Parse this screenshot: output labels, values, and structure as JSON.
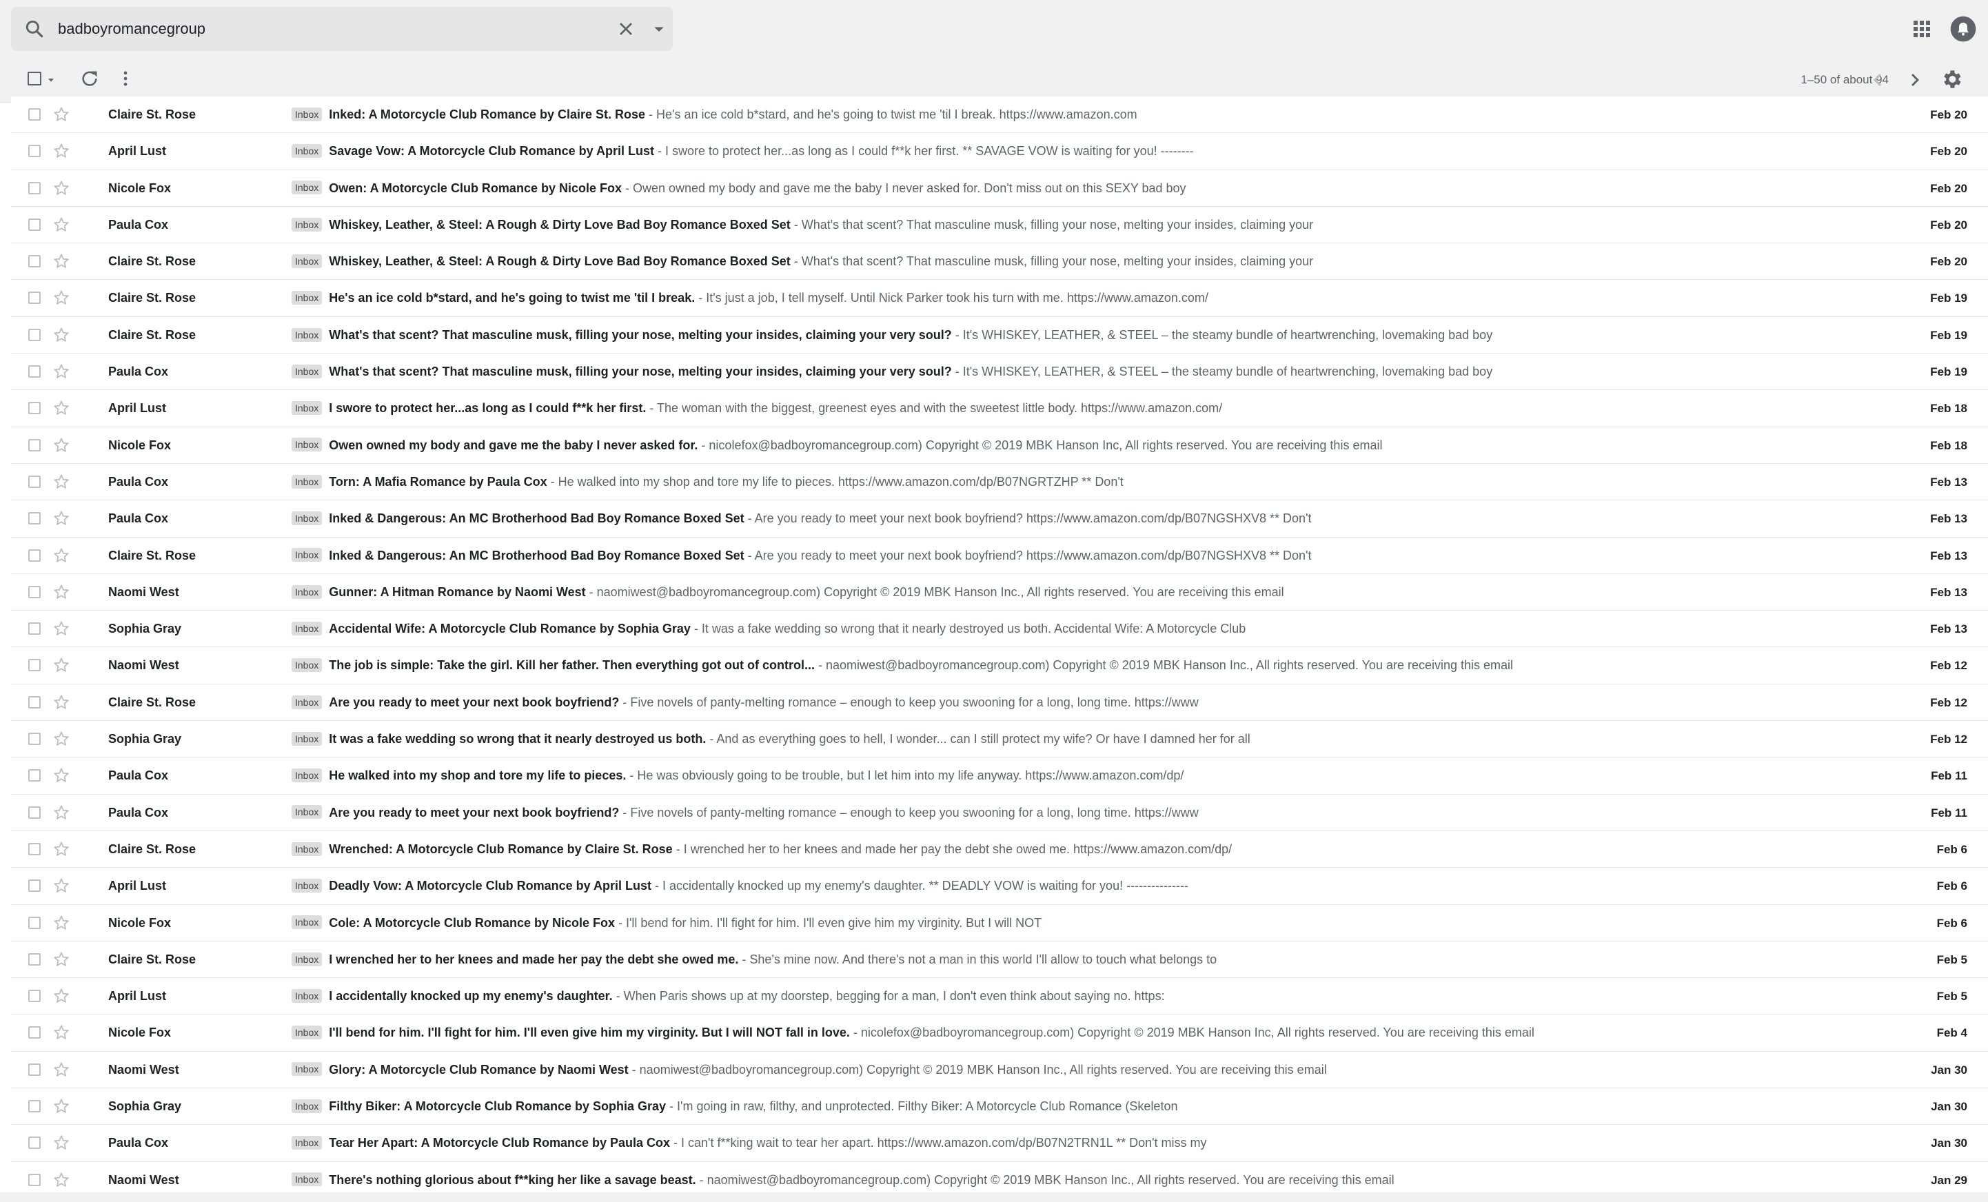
{
  "search": {
    "query": "badboyromancegroup"
  },
  "toolbar": {
    "page_count": "1–50 of about 94"
  },
  "icons": {
    "search": "search-icon",
    "clear": "close-icon",
    "search_options": "caret-down-icon",
    "apps": "apps-grid-icon",
    "notifications": "bell-icon",
    "refresh": "refresh-icon",
    "more": "more-vert-icon",
    "prev": "chevron-left-icon",
    "next": "chevron-right-icon",
    "settings": "gear-icon",
    "star": "star-outline-icon"
  },
  "colors": {
    "topbar_bg": "#f1f1f1",
    "badge_bg": "#dddddd",
    "text_primary": "#202124",
    "text_secondary": "#5f6368"
  },
  "emails": [
    {
      "sender": "Claire St. Rose",
      "label": "Inbox",
      "subject": "Inked: A Motorcycle Club Romance by Claire St. Rose",
      "snippet": " - He's an ice cold b*stard, and he's going to twist me 'til I break. https://www.amazon.com",
      "date": "Feb 20"
    },
    {
      "sender": "April Lust",
      "label": "Inbox",
      "subject": "Savage Vow: A Motorcycle Club Romance by April Lust",
      "snippet": " - I swore to protect her...as long as I could f**k her first. ** SAVAGE VOW is waiting for you! --------",
      "date": "Feb 20"
    },
    {
      "sender": "Nicole Fox",
      "label": "Inbox",
      "subject": "Owen: A Motorcycle Club Romance by Nicole Fox",
      "snippet": " - Owen owned my body and gave me the baby I never asked for. Don't miss out on this SEXY bad boy",
      "date": "Feb 20"
    },
    {
      "sender": "Paula Cox",
      "label": "Inbox",
      "subject": "Whiskey, Leather, & Steel: A Rough & Dirty Love Bad Boy Romance Boxed Set",
      "snippet": " - What's that scent? That masculine musk, filling your nose, melting your insides, claiming your",
      "date": "Feb 20"
    },
    {
      "sender": "Claire St. Rose",
      "label": "Inbox",
      "subject": "Whiskey, Leather, & Steel: A Rough & Dirty Love Bad Boy Romance Boxed Set",
      "snippet": " - What's that scent? That masculine musk, filling your nose, melting your insides, claiming your",
      "date": "Feb 20"
    },
    {
      "sender": "Claire St. Rose",
      "label": "Inbox",
      "subject": "He's an ice cold b*stard, and he's going to twist me 'til I break.",
      "snippet": " - It's just a job, I tell myself. Until Nick Parker took his turn with me. https://www.amazon.com/",
      "date": "Feb 19"
    },
    {
      "sender": "Claire St. Rose",
      "label": "Inbox",
      "subject": "What's that scent? That masculine musk, filling your nose, melting your insides, claiming your very soul?",
      "snippet": " - It's WHISKEY, LEATHER, & STEEL – the steamy bundle of heartwrenching, lovemaking bad boy",
      "date": "Feb 19"
    },
    {
      "sender": "Paula Cox",
      "label": "Inbox",
      "subject": "What's that scent? That masculine musk, filling your nose, melting your insides, claiming your very soul?",
      "snippet": " - It's WHISKEY, LEATHER, & STEEL – the steamy bundle of heartwrenching, lovemaking bad boy",
      "date": "Feb 19"
    },
    {
      "sender": "April Lust",
      "label": "Inbox",
      "subject": "I swore to protect her...as long as I could f**k her first.",
      "snippet": " - The woman with the biggest, greenest eyes and with the sweetest little body. https://www.amazon.com/",
      "date": "Feb 18"
    },
    {
      "sender": "Nicole Fox",
      "label": "Inbox",
      "subject": "Owen owned my body and gave me the baby I never asked for.",
      "snippet": " - nicolefox@badboyromancegroup.com) Copyright © 2019 MBK Hanson Inc, All rights reserved. You are receiving this email",
      "date": "Feb 18"
    },
    {
      "sender": "Paula Cox",
      "label": "Inbox",
      "subject": "Torn: A Mafia Romance by Paula Cox",
      "snippet": " - He walked into my shop and tore my life to pieces. https://www.amazon.com/dp/B07NGRTZHP ** Don't",
      "date": "Feb 13"
    },
    {
      "sender": "Paula Cox",
      "label": "Inbox",
      "subject": "Inked & Dangerous: An MC Brotherhood Bad Boy Romance Boxed Set",
      "snippet": " - Are you ready to meet your next book boyfriend? https://www.amazon.com/dp/B07NGSHXV8 ** Don't",
      "date": "Feb 13"
    },
    {
      "sender": "Claire St. Rose",
      "label": "Inbox",
      "subject": "Inked & Dangerous: An MC Brotherhood Bad Boy Romance Boxed Set",
      "snippet": " - Are you ready to meet your next book boyfriend? https://www.amazon.com/dp/B07NGSHXV8 ** Don't",
      "date": "Feb 13"
    },
    {
      "sender": "Naomi West",
      "label": "Inbox",
      "subject": "Gunner: A Hitman Romance by Naomi West",
      "snippet": " - naomiwest@badboyromancegroup.com) Copyright © 2019 MBK Hanson Inc., All rights reserved. You are receiving this email",
      "date": "Feb 13"
    },
    {
      "sender": "Sophia Gray",
      "label": "Inbox",
      "subject": "Accidental Wife: A Motorcycle Club Romance by Sophia Gray",
      "snippet": " - It was a fake wedding so wrong that it nearly destroyed us both. Accidental Wife: A Motorcycle Club",
      "date": "Feb 13"
    },
    {
      "sender": "Naomi West",
      "label": "Inbox",
      "subject": "The job is simple: Take the girl. Kill her father. Then everything got out of control...",
      "snippet": " - naomiwest@badboyromancegroup.com) Copyright © 2019 MBK Hanson Inc., All rights reserved. You are receiving this email",
      "date": "Feb 12"
    },
    {
      "sender": "Claire St. Rose",
      "label": "Inbox",
      "subject": "Are you ready to meet your next book boyfriend?",
      "snippet": " - Five novels of panty-melting romance – enough to keep you swooning for a long, long time. https://www",
      "date": "Feb 12"
    },
    {
      "sender": "Sophia Gray",
      "label": "Inbox",
      "subject": "It was a fake wedding so wrong that it nearly destroyed us both.",
      "snippet": " - And as everything goes to hell, I wonder... can I still protect my wife? Or have I damned her for all",
      "date": "Feb 12"
    },
    {
      "sender": "Paula Cox",
      "label": "Inbox",
      "subject": "He walked into my shop and tore my life to pieces.",
      "snippet": " - He was obviously going to be trouble, but I let him into my life anyway. https://www.amazon.com/dp/",
      "date": "Feb 11"
    },
    {
      "sender": "Paula Cox",
      "label": "Inbox",
      "subject": "Are you ready to meet your next book boyfriend?",
      "snippet": " - Five novels of panty-melting romance – enough to keep you swooning for a long, long time. https://www",
      "date": "Feb 11"
    },
    {
      "sender": "Claire St. Rose",
      "label": "Inbox",
      "subject": "Wrenched: A Motorcycle Club Romance by Claire St. Rose",
      "snippet": " - I wrenched her to her knees and made her pay the debt she owed me. https://www.amazon.com/dp/",
      "date": "Feb 6"
    },
    {
      "sender": "April Lust",
      "label": "Inbox",
      "subject": "Deadly Vow: A Motorcycle Club Romance by April Lust",
      "snippet": " - I accidentally knocked up my enemy's daughter. ** DEADLY VOW is waiting for you! ---------------",
      "date": "Feb 6"
    },
    {
      "sender": "Nicole Fox",
      "label": "Inbox",
      "subject": "Cole: A Motorcycle Club Romance by Nicole Fox",
      "snippet": " - I'll bend for him. I'll fight for him. I'll even give him my virginity. But I will NOT",
      "date": "Feb 6"
    },
    {
      "sender": "Claire St. Rose",
      "label": "Inbox",
      "subject": "I wrenched her to her knees and made her pay the debt she owed me.",
      "snippet": " - She's mine now. And there's not a man in this world I'll allow to touch what belongs to",
      "date": "Feb 5"
    },
    {
      "sender": "April Lust",
      "label": "Inbox",
      "subject": "I accidentally knocked up my enemy's daughter.",
      "snippet": " - When Paris shows up at my doorstep, begging for a man, I don't even think about saying no. https:",
      "date": "Feb 5"
    },
    {
      "sender": "Nicole Fox",
      "label": "Inbox",
      "subject": "I'll bend for him. I'll fight for him. I'll even give him my virginity. But I will NOT fall in love.",
      "snippet": " - nicolefox@badboyromancegroup.com) Copyright © 2019 MBK Hanson Inc, All rights reserved. You are receiving this email",
      "date": "Feb 4"
    },
    {
      "sender": "Naomi West",
      "label": "Inbox",
      "subject": "Glory: A Motorcycle Club Romance by Naomi West",
      "snippet": " - naomiwest@badboyromancegroup.com) Copyright © 2019 MBK Hanson Inc., All rights reserved. You are receiving this email",
      "date": "Jan 30"
    },
    {
      "sender": "Sophia Gray",
      "label": "Inbox",
      "subject": "Filthy Biker: A Motorcycle Club Romance by Sophia Gray",
      "snippet": " - I'm going in raw, filthy, and unprotected. Filthy Biker: A Motorcycle Club Romance (Skeleton",
      "date": "Jan 30"
    },
    {
      "sender": "Paula Cox",
      "label": "Inbox",
      "subject": "Tear Her Apart: A Motorcycle Club Romance by Paula Cox",
      "snippet": " - I can't f**king wait to tear her apart. https://www.amazon.com/dp/B07N2TRN1L ** Don't miss my",
      "date": "Jan 30"
    },
    {
      "sender": "Naomi West",
      "label": "Inbox",
      "subject": "There's nothing glorious about f**king her like a savage beast.",
      "snippet": " - naomiwest@badboyromancegroup.com) Copyright © 2019 MBK Hanson Inc., All rights reserved. You are receiving this email",
      "date": "Jan 29"
    }
  ]
}
